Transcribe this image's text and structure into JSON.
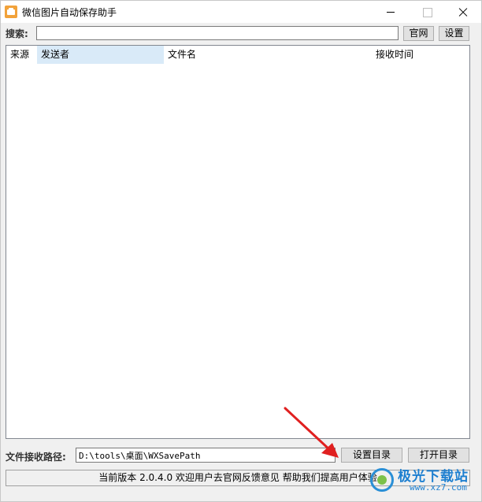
{
  "window": {
    "title": "微信图片自动保存助手"
  },
  "search": {
    "label": "搜索:",
    "value": "",
    "placeholder": "",
    "official_site_label": "官网",
    "settings_label": "设置"
  },
  "list": {
    "columns": [
      "来源",
      "发送者",
      "文件名",
      "接收时间"
    ],
    "rows": []
  },
  "path": {
    "label": "文件接收路径:",
    "value": "D:\\tools\\桌面\\WXSavePath",
    "set_dir_label": "设置目录",
    "open_dir_label": "打开目录"
  },
  "status": {
    "text": "当前版本 2.0.4.0 欢迎用户去官网反馈意见 帮助我们提高用户体验"
  },
  "watermark": {
    "name": "极光下载站",
    "url": "www.xz7.com"
  },
  "colors": {
    "accent_arrow": "#e02020",
    "selected_header": "#d9eaf8",
    "app_icon": "#f2a23a"
  }
}
